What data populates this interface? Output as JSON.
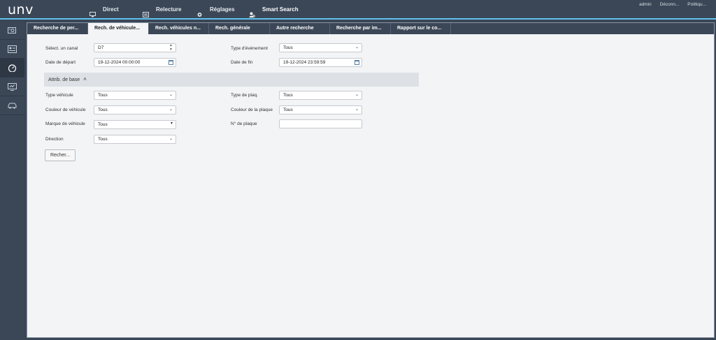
{
  "logo": "unv",
  "nav": {
    "live": "Direct",
    "playback": "Relecture",
    "settings": "Réglages",
    "smart_search": "Smart Search"
  },
  "topright": {
    "user": "admin",
    "logout": "Déconn...",
    "policy": "Politiqu..."
  },
  "tabs": [
    "Recherche de per...",
    "Rech. de véhicule...",
    "Rech. véhicules n...",
    "Rech. générale",
    "Autre recherche",
    "Recherche par im...",
    "Rapport sur le co..."
  ],
  "form": {
    "channel_label": "Sélect. un canal",
    "channel_value": "D7",
    "event_type_label": "Type d'événement",
    "event_type_value": "Tous",
    "start_label": "Date de départ",
    "start_value": "19-12-2024 00:00:00",
    "end_label": "Date de fin",
    "end_value": "19-12-2024 23:59:59",
    "section_title": "Attrib. de base",
    "vehicle_type_label": "Type véhicule",
    "vehicle_type_value": "Tous",
    "plate_type_label": "Type de plaq.",
    "plate_type_value": "Tous",
    "vehicle_color_label": "Couleur de véhicule",
    "vehicle_color_value": "Tous",
    "plate_color_label": "Couleur de la plaque",
    "plate_color_value": "Tous",
    "brand_label": "Marque de véhicule",
    "brand_value": "Tous",
    "plate_no_label": "N° de plaque",
    "plate_no_value": "",
    "direction_label": "Direction",
    "direction_value": "Tous",
    "search_button": "Recher..."
  },
  "colors": {
    "bar": "#3b4757",
    "accent": "#5ec3f0",
    "panel": "#f3f4f6"
  }
}
